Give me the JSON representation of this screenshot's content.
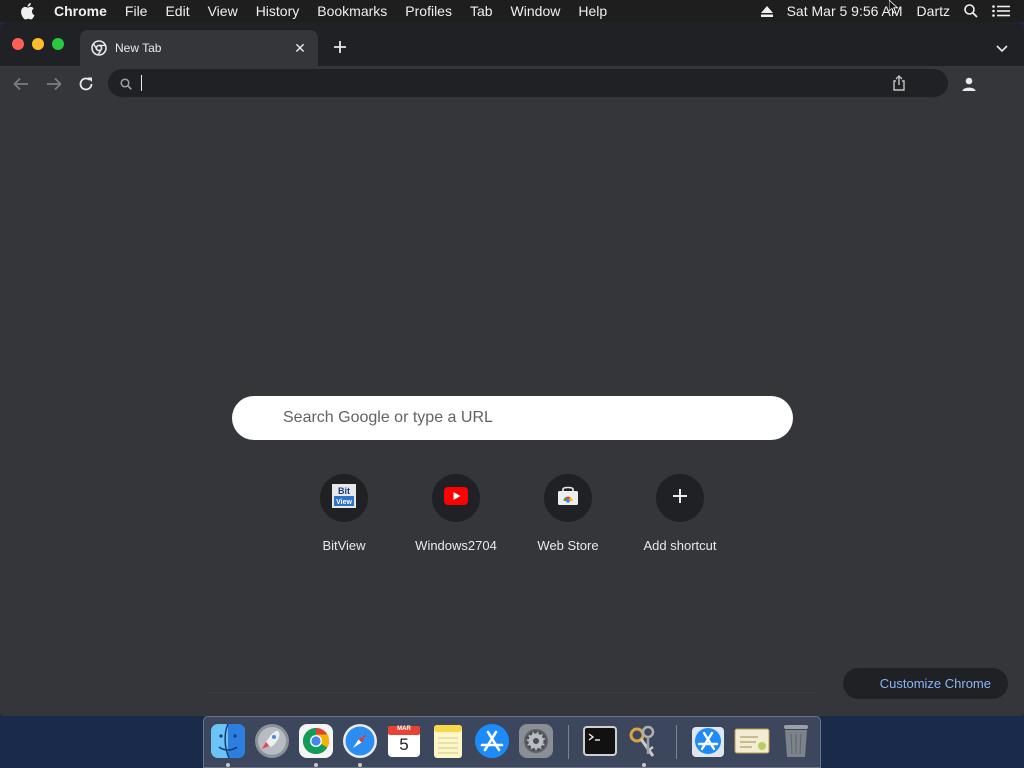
{
  "menubar": {
    "app_name": "Chrome",
    "items": [
      "File",
      "Edit",
      "View",
      "History",
      "Bookmarks",
      "Profiles",
      "Tab",
      "Window",
      "Help"
    ],
    "clock": "Sat Mar 5  9:56 AM",
    "user": "Dartz"
  },
  "tab": {
    "title": "New Tab",
    "close_glyph": "✕"
  },
  "newtab_glyph": "+",
  "omnibox": {
    "value": ""
  },
  "search": {
    "placeholder": "Search Google or type a URL"
  },
  "shortcuts": [
    {
      "label": "BitView",
      "icon": "bitview-icon"
    },
    {
      "label": "Windows2704",
      "icon": "youtube-icon"
    },
    {
      "label": "Web Store",
      "icon": "web-store-icon"
    },
    {
      "label": "Add shortcut",
      "icon": "plus-icon"
    }
  ],
  "customize": {
    "label": "Customize Chrome"
  },
  "calendar": {
    "month": "MAR",
    "day": "5"
  },
  "colors": {
    "window_bg": "#35363a",
    "tabstrip_bg": "#202124",
    "accent_link": "#8ab4f8",
    "text": "#e8eaed"
  }
}
